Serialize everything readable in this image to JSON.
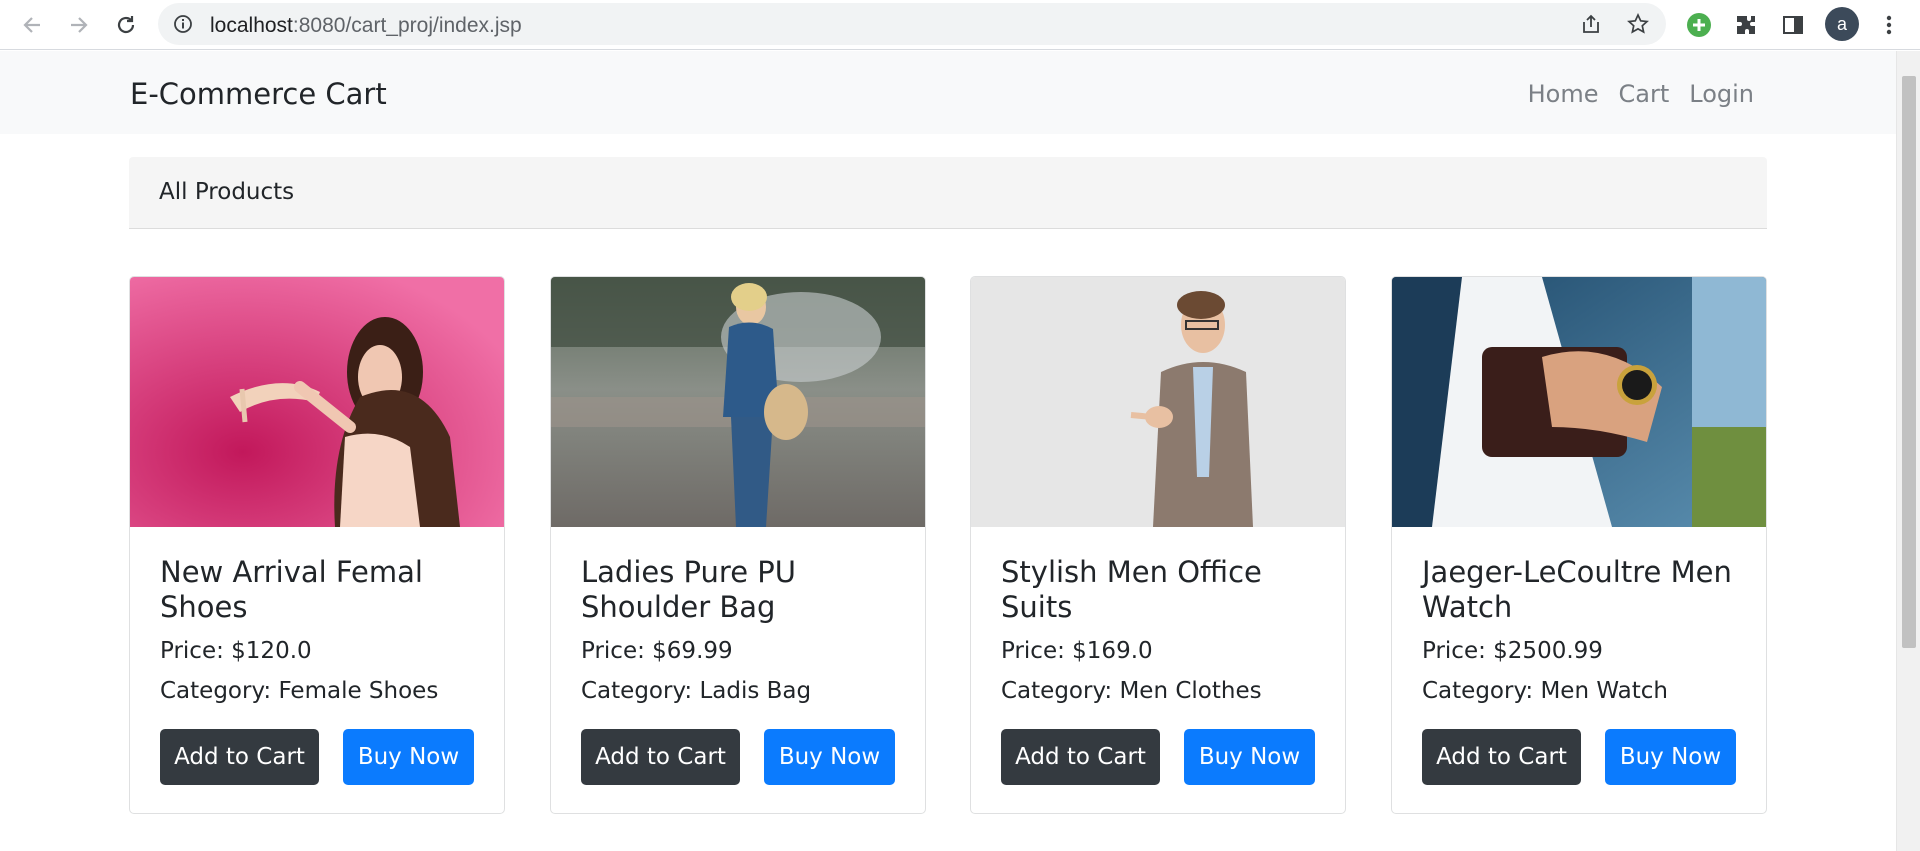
{
  "browser": {
    "url_host": "localhost",
    "url_path": ":8080/cart_proj/index.jsp",
    "profile_initial": "a"
  },
  "navbar": {
    "brand": "E-Commerce Cart",
    "links": [
      {
        "label": "Home"
      },
      {
        "label": "Cart"
      },
      {
        "label": "Login"
      }
    ]
  },
  "section": {
    "title": "All Products"
  },
  "products": [
    {
      "title": "New Arrival Femal Shoes",
      "price": "Price: $120.0",
      "category": "Category: Female Shoes",
      "add_label": "Add to Cart",
      "buy_label": "Buy Now"
    },
    {
      "title": "Ladies Pure PU Shoulder Bag",
      "price": "Price: $69.99",
      "category": "Category: Ladis Bag",
      "add_label": "Add to Cart",
      "buy_label": "Buy Now"
    },
    {
      "title": "Stylish Men Office Suits",
      "price": "Price: $169.0",
      "category": "Category: Men Clothes",
      "add_label": "Add to Cart",
      "buy_label": "Buy Now"
    },
    {
      "title": "Jaeger-LeCoultre Men Watch",
      "price": "Price: $2500.99",
      "category": "Category: Men Watch",
      "add_label": "Add to Cart",
      "buy_label": "Buy Now"
    }
  ],
  "colors": {
    "dark_button": "#343a40",
    "primary_button": "#0b7bfe",
    "navbar_bg": "#f8f9fa"
  }
}
